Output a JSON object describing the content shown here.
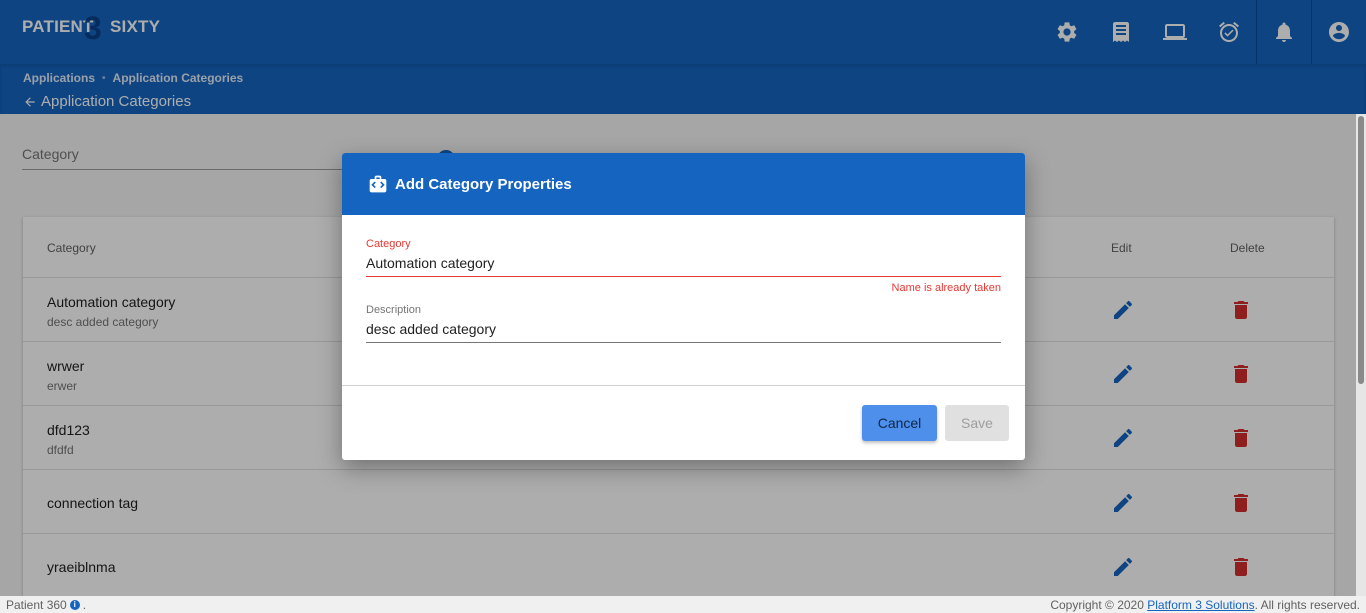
{
  "app": {
    "logo": {
      "part1": "PATIENT",
      "part2": "3",
      "part3": "SIXTY"
    },
    "top_icons": [
      "gear-icon",
      "receipt-icon",
      "laptop-icon",
      "alarm-clock-icon",
      "bell-icon",
      "account-circle-icon"
    ]
  },
  "breadcrumb": {
    "items": [
      "Applications",
      "Application Categories"
    ],
    "back_label": "Application Categories"
  },
  "filter": {
    "placeholder": "Category"
  },
  "table": {
    "headers": {
      "category": "Category",
      "edit": "Edit",
      "delete": "Delete"
    },
    "rows": [
      {
        "name": "Automation category",
        "description": "desc added category"
      },
      {
        "name": "wrwer",
        "description": "erwer"
      },
      {
        "name": "dfd123",
        "description": "dfdfd"
      },
      {
        "name": "connection tag",
        "description": ""
      },
      {
        "name": "yraeiblnma",
        "description": ""
      }
    ]
  },
  "dialog": {
    "title": "Add Category Properties",
    "category_label": "Category",
    "category_value": "Automation category",
    "category_error": "Name is already taken",
    "description_label": "Description",
    "description_value": "desc added category",
    "cancel_label": "Cancel",
    "save_label": "Save"
  },
  "footer": {
    "app_name": "Patient 360",
    "copyright_prefix": "Copyright © 2020",
    "company_link": "Platform 3 Solutions",
    "copyright_suffix": ". All rights reserved."
  },
  "colors": {
    "primary": "#1565c0",
    "error": "#e53935",
    "delete": "#d32f2f",
    "cancel_button": "#4f8fec"
  }
}
